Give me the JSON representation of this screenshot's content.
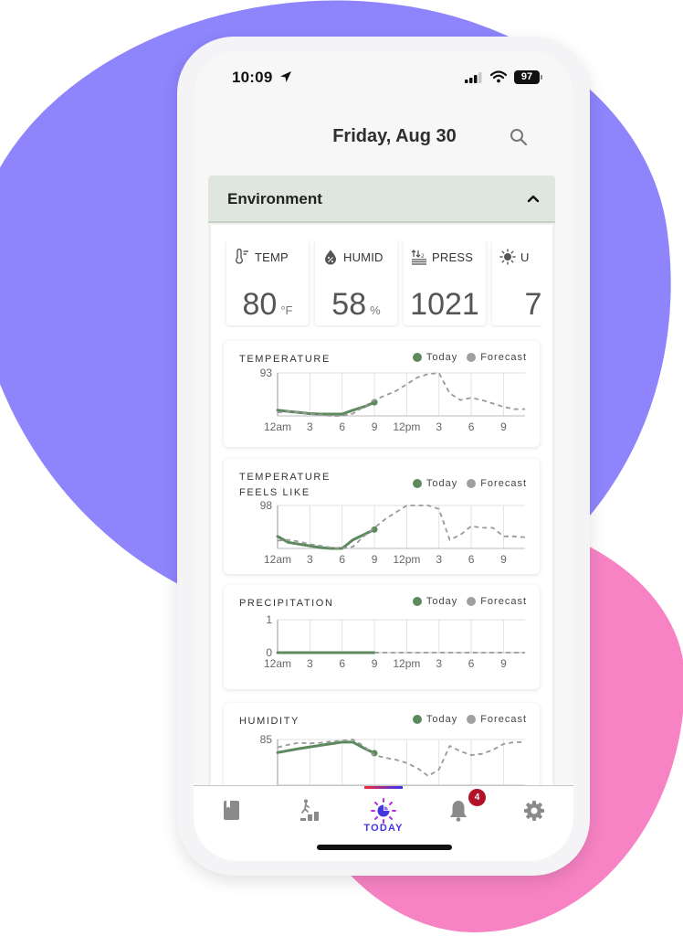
{
  "status_bar": {
    "time": "10:09",
    "battery": "97"
  },
  "header": {
    "title": "Friday, Aug 30",
    "search_icon": "search-icon"
  },
  "section": {
    "title": "Environment",
    "collapse_icon": "chevron-up-icon"
  },
  "metrics": [
    {
      "label": "TEMP",
      "value": "80",
      "unit": "°F",
      "icon": "thermometer-icon"
    },
    {
      "label": "HUMID",
      "value": "58",
      "unit": "%",
      "icon": "humidity-drop-icon"
    },
    {
      "label": "PRESS",
      "value": "1021",
      "unit": "",
      "icon": "pressure-icon"
    },
    {
      "label": "U",
      "value": "7",
      "unit": "",
      "icon": "sun-icon"
    }
  ],
  "legend": {
    "today": "Today",
    "forecast": "Forecast",
    "today_color": "#5c8a5c",
    "forecast_color": "#a0a0a0"
  },
  "colors": {
    "accent_today": "#5c8a5c",
    "forecast_line": "#999999",
    "nav_active": "#4536e0",
    "badge": "#b3102a",
    "section_header_bg": "#dfe6df"
  },
  "chart_data": [
    {
      "type": "line",
      "title": "TEMPERATURE",
      "x_ticks": [
        "12am",
        "3",
        "6",
        "9",
        "12pm",
        "3",
        "6",
        "9"
      ],
      "y_ticks": [
        "93"
      ],
      "ylim": [
        74,
        93
      ],
      "x_range_hours": [
        0,
        23
      ],
      "series": [
        {
          "name": "Today",
          "x": [
            0,
            1,
            2,
            3,
            4,
            5,
            6,
            7,
            8,
            9
          ],
          "values": [
            76.5,
            76.0,
            75.5,
            75.0,
            74.8,
            74.8,
            74.8,
            76.5,
            78.0,
            80.0
          ]
        },
        {
          "name": "Forecast",
          "x": [
            0,
            1,
            2,
            3,
            4,
            5,
            6,
            7,
            8,
            9,
            10,
            11,
            12,
            13,
            14,
            15,
            16,
            17,
            18,
            19,
            20,
            21,
            22,
            23
          ],
          "values": [
            75.5,
            76.0,
            75.5,
            74.8,
            74.5,
            74.0,
            74.0,
            75.0,
            78.0,
            81.0,
            83.0,
            85.0,
            88.0,
            91.0,
            92.5,
            93.0,
            84.0,
            81.0,
            82.0,
            81.0,
            79.5,
            78.0,
            77.0,
            77.0
          ]
        }
      ]
    },
    {
      "type": "line",
      "title": "TEMPERATURE FEELS LIKE",
      "x_ticks": [
        "12am",
        "3",
        "6",
        "9",
        "12pm",
        "3",
        "6",
        "9"
      ],
      "y_ticks": [
        "98"
      ],
      "ylim": [
        73,
        98
      ],
      "x_range_hours": [
        0,
        23
      ],
      "series": [
        {
          "name": "Today",
          "x": [
            0,
            1,
            2,
            3,
            4,
            5,
            6,
            7,
            8,
            9
          ],
          "values": [
            80.0,
            76.5,
            75.5,
            74.5,
            73.5,
            73.0,
            73.0,
            78.0,
            81.0,
            84.0
          ]
        },
        {
          "name": "Forecast",
          "x": [
            0,
            1,
            2,
            3,
            4,
            5,
            6,
            7,
            8,
            9,
            10,
            11,
            12,
            13,
            14,
            15,
            16,
            17,
            18,
            19,
            20,
            21,
            22,
            23
          ],
          "values": [
            77.5,
            78.0,
            77.0,
            75.5,
            74.5,
            73.5,
            73.0,
            74.0,
            80.0,
            85.0,
            90.0,
            94.0,
            98.0,
            98.0,
            98.0,
            96.0,
            78.0,
            81.0,
            86.0,
            85.0,
            85.0,
            80.0,
            80.0,
            79.5
          ]
        }
      ]
    },
    {
      "type": "line",
      "title": "PRECIPITATION",
      "x_ticks": [
        "12am",
        "3",
        "6",
        "9",
        "12pm",
        "3",
        "6",
        "9"
      ],
      "y_ticks": [
        "1",
        "0"
      ],
      "ylim": [
        0,
        1
      ],
      "x_range_hours": [
        0,
        23
      ],
      "series": [
        {
          "name": "Today",
          "x": [
            0,
            9
          ],
          "values": [
            0,
            0
          ]
        },
        {
          "name": "Forecast",
          "x": [
            9,
            23
          ],
          "values": [
            0,
            0
          ]
        }
      ]
    },
    {
      "type": "line",
      "title": "HUMIDITY",
      "x_ticks": [],
      "y_ticks": [
        "85"
      ],
      "ylim": [
        50,
        85
      ],
      "x_range_hours": [
        0,
        23
      ],
      "series": [
        {
          "name": "Today",
          "x": [
            0,
            2,
            4,
            6,
            7,
            8,
            9
          ],
          "values": [
            75.0,
            78.0,
            80.5,
            83.0,
            83.0,
            78.5,
            74.5
          ]
        },
        {
          "name": "Forecast",
          "x": [
            0,
            1,
            2,
            3,
            4,
            5,
            6,
            7,
            8,
            9,
            10,
            11,
            12,
            13,
            14,
            15,
            16,
            17,
            18,
            19,
            20,
            21,
            22,
            23
          ],
          "values": [
            79.0,
            81.0,
            82.5,
            82.0,
            82.5,
            83.5,
            84.0,
            85.0,
            80.0,
            73.0,
            71.0,
            69.5,
            67.0,
            63.0,
            57.0,
            62.0,
            80.0,
            76.0,
            73.0,
            74.0,
            77.0,
            81.5,
            83.0,
            83.0
          ]
        }
      ]
    }
  ],
  "bottom_nav": {
    "items": [
      {
        "name": "journal",
        "icon": "book-icon",
        "label": ""
      },
      {
        "name": "activity",
        "icon": "activity-steps-icon",
        "label": ""
      },
      {
        "name": "today",
        "icon": "today-sun-icon",
        "label": "TODAY",
        "active": true
      },
      {
        "name": "notifications",
        "icon": "bell-icon",
        "label": "",
        "badge": "4"
      },
      {
        "name": "settings",
        "icon": "gear-icon",
        "label": ""
      }
    ]
  }
}
